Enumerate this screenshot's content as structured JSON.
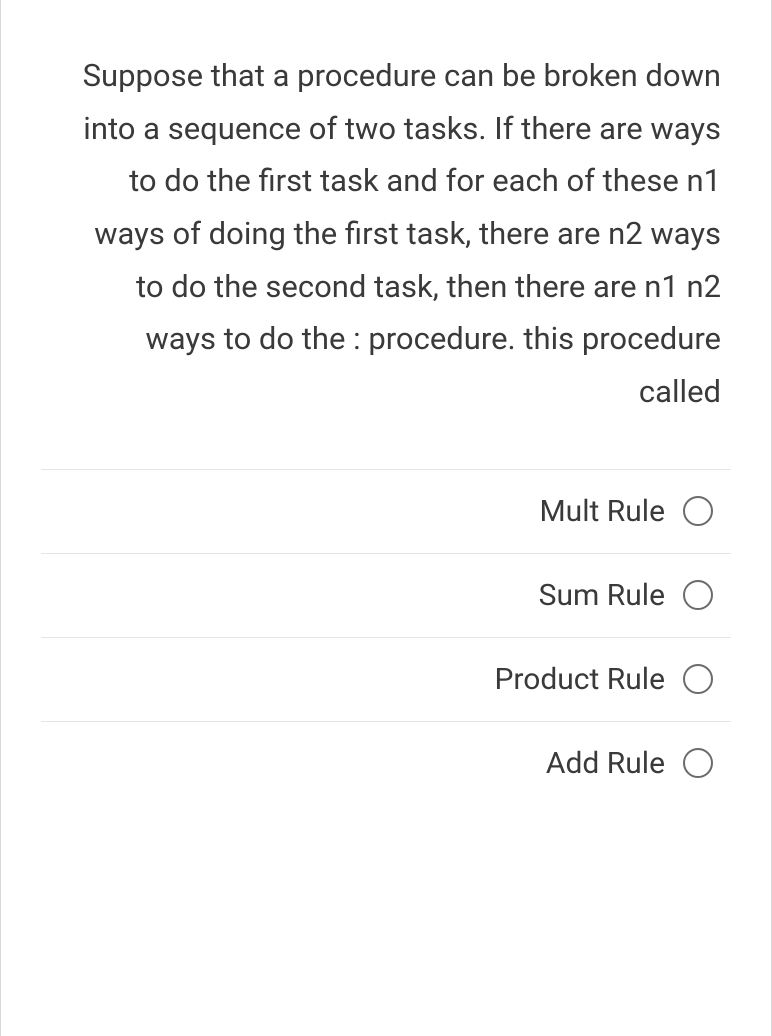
{
  "question": {
    "text": "Suppose that a procedure can be broken down into a sequence of two tasks. If there are ways to do the first task and for each of these n1 ways of doing the first task, there are n2 ways to do the second task, then there are n1 n2 ways to do the : procedure. this procedure called"
  },
  "options": [
    {
      "label": "Mult Rule"
    },
    {
      "label": "Sum Rule"
    },
    {
      "label": "Product Rule"
    },
    {
      "label": "Add Rule"
    }
  ]
}
